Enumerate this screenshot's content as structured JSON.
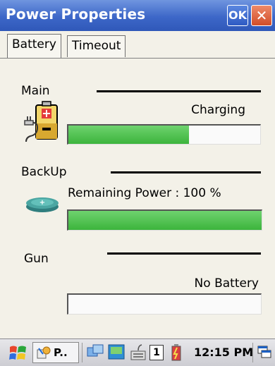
{
  "window": {
    "title": "Power Properties",
    "ok_label": "OK",
    "close_label": "✕"
  },
  "tabs": [
    {
      "label": "Battery",
      "active": true
    },
    {
      "label": "Timeout",
      "active": false
    }
  ],
  "main": {
    "label": "Main",
    "status": "Charging",
    "level": 0.63
  },
  "backup": {
    "label": "BackUp",
    "status": "Remaining Power :  100 %",
    "level": 1.0
  },
  "gun": {
    "label": "Gun",
    "status": "No Battery",
    "level": 0.0
  },
  "taskbar": {
    "task_label": "P..",
    "input_panel_number": "1",
    "clock": "12:15 PM"
  },
  "colors": {
    "titlebar": "#3d67c8",
    "fill": "#3cb43c",
    "background": "#f3f1e8"
  }
}
